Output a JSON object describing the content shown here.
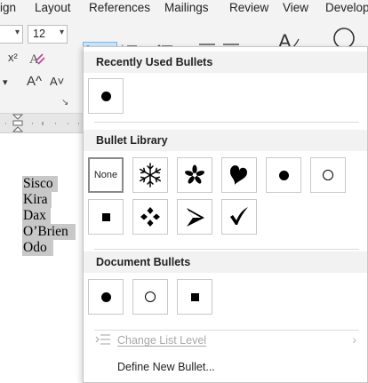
{
  "ribbon": {
    "tabs": [
      "ign",
      "Layout",
      "References",
      "Mailings",
      "Review",
      "View",
      "Develop"
    ],
    "font_size_value": "12",
    "superscript_label": "x²",
    "grow_font_label": "A^",
    "shrink_font_label": "A˅"
  },
  "document": {
    "lines": [
      "Sisco",
      "Kira",
      "Dax",
      "O’Brien",
      "Odo"
    ]
  },
  "bullets_menu": {
    "recent_title": "Recently Used Bullets",
    "library_title": "Bullet Library",
    "document_title": "Document Bullets",
    "none_label": "None",
    "library_bullets": [
      "none-icon",
      "snowflake-icon",
      "asterisk-icon",
      "heart-icon",
      "dot-icon",
      "ring-icon",
      "square-icon",
      "diamond-cluster-icon",
      "arrowhead-icon",
      "checkmark-icon"
    ],
    "document_bullets": [
      "dot-icon",
      "ring-icon",
      "square-icon"
    ],
    "change_level_label": "Change List Level",
    "define_label": "Define New Bullet..."
  }
}
